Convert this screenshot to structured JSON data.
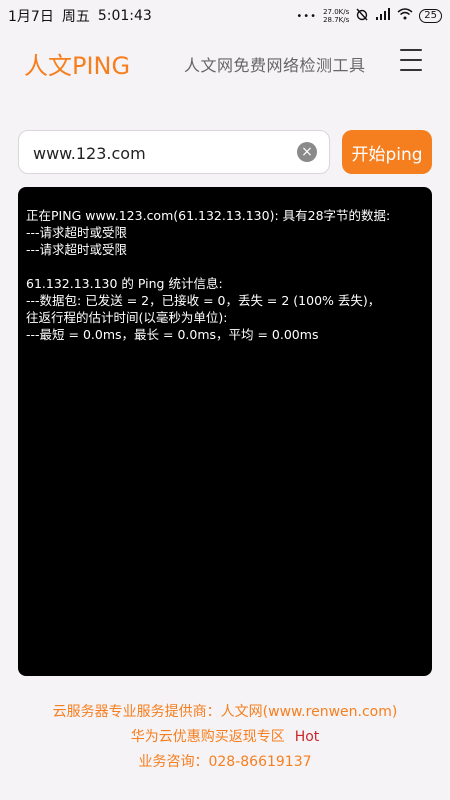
{
  "status_bar": {
    "date": "1月7日",
    "weekday": "周五",
    "time": "5:01:43",
    "dots": "•••",
    "speed_up": "27.0K/s",
    "speed_down": "28.7K/s",
    "battery": "25"
  },
  "header": {
    "title": "人文PING",
    "subtitle": "人文网免费网络检测工具"
  },
  "search": {
    "value": "www.123.com",
    "clear_symbol": "×"
  },
  "ping_button": {
    "label": "开始ping"
  },
  "console": {
    "lines": [
      "正在PING www.123.com(61.132.13.130): 具有28字节的数据:",
      "---请求超时或受限",
      "---请求超时或受限",
      "",
      "61.132.13.130 的 Ping 统计信息:",
      "---数据包: 已发送 = 2，已接收 = 0，丢失 = 2 (100% 丢失)，",
      "往返行程的估计时间(以毫秒为单位):",
      "---最短 = 0.0ms，最长 = 0.0ms，平均 = 0.00ms"
    ]
  },
  "footer": {
    "provider": "云服务器专业服务提供商：人文网(www.renwen.com)",
    "promo": "华为云优惠购买返现专区",
    "hot": "Hot",
    "contact": "业务咨询：028-86619137"
  },
  "colors": {
    "accent": "#f57f1f",
    "hot": "#c92a2a",
    "background": "#f6f3f6"
  }
}
